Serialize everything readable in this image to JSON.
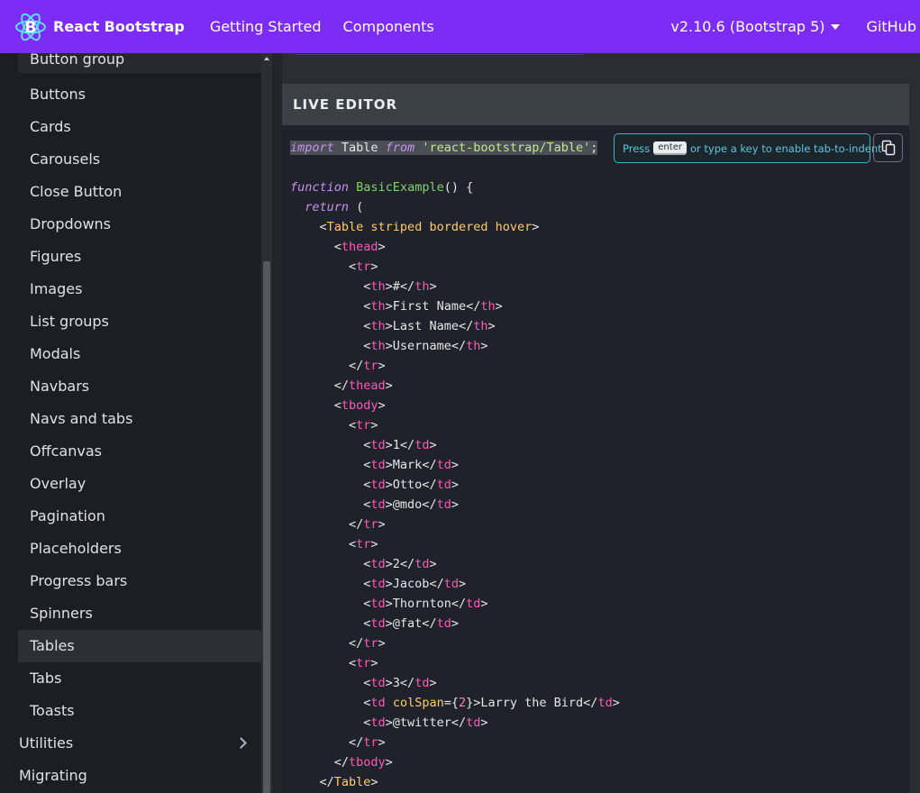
{
  "navbar": {
    "brand": "React Bootstrap",
    "links": [
      "Getting Started",
      "Components"
    ],
    "version": "v2.10.6 (Bootstrap 5)",
    "github": "GitHub",
    "bg_color": "#7c2cf5"
  },
  "sidebar": {
    "items": [
      "Button group",
      "Buttons",
      "Cards",
      "Carousels",
      "Close Button",
      "Dropdowns",
      "Figures",
      "Images",
      "List groups",
      "Modals",
      "Navbars",
      "Navs and tabs",
      "Offcanvas",
      "Overlay",
      "Pagination",
      "Placeholders",
      "Progress bars",
      "Spinners",
      "Tables",
      "Tabs",
      "Toasts"
    ],
    "active": "Tables",
    "categories": [
      "Utilities",
      "Migrating"
    ]
  },
  "editor": {
    "header": "LIVE EDITOR",
    "tip": {
      "before": "Press",
      "key": "enter",
      "after": "or type a key to enable tab-to-indent"
    },
    "copy_icon": "copy-icon"
  }
}
